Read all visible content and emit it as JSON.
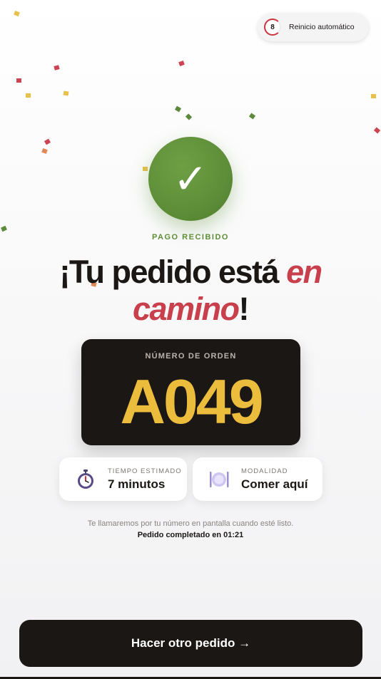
{
  "auto_reset": {
    "countdown": "8",
    "label": "Reinicio automático"
  },
  "status": {
    "eyebrow": "PAGO RECIBIDO"
  },
  "headline": {
    "part1": "¡Tu pedido está ",
    "emphasis1": "en",
    "emphasis2": "camino",
    "end": "!"
  },
  "order": {
    "label": "NÚMERO DE ORDEN",
    "number": "A049"
  },
  "eta": {
    "label": "TIEMPO ESTIMADO",
    "value": "7 minutos",
    "icon": "stopwatch-icon"
  },
  "mode": {
    "label": "MODALIDAD",
    "value": "Comer aquí",
    "icon": "plate-cutlery-icon"
  },
  "note": "Te llamaremos por tu número en pantalla cuando esté listo.",
  "completed": "Pedido completado en 01:21",
  "cta": {
    "label": "Hacer otro pedido →"
  },
  "colors": {
    "accent_red": "#c9404d",
    "success_green": "#5e8e38",
    "order_yellow": "#ecbd3d",
    "dark": "#1b1715"
  }
}
